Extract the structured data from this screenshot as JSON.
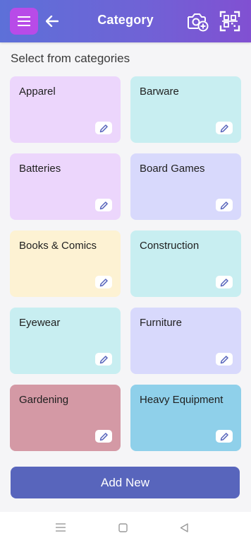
{
  "app_bar": {
    "title": "Category"
  },
  "icons": {
    "menu": "hamburger-menu-icon",
    "back": "arrow-left-icon",
    "camera": "camera-add-icon",
    "scan": "qr-scan-icon",
    "edit": "pencil-icon"
  },
  "section_heading": "Select from categories",
  "categories": [
    {
      "name": "Apparel",
      "color": "#ecd6fc"
    },
    {
      "name": "Barware",
      "color": "#c8eef1"
    },
    {
      "name": "Batteries",
      "color": "#ecd6fc"
    },
    {
      "name": "Board Games",
      "color": "#d8d9fc"
    },
    {
      "name": "Books & Comics",
      "color": "#fdf2d3"
    },
    {
      "name": "Construction",
      "color": "#c8eef1"
    },
    {
      "name": "Eyewear",
      "color": "#c8eef1"
    },
    {
      "name": "Furniture",
      "color": "#d8d9fc"
    },
    {
      "name": "Gardening",
      "color": "#d499a5"
    },
    {
      "name": "Heavy Equipment",
      "color": "#8fd0ea"
    }
  ],
  "add_button_label": "Add New",
  "colors": {
    "app_bar_start": "#5d70d8",
    "app_bar_end": "#8150d2",
    "menu_button": "#b84be8",
    "add_button": "#5865bc",
    "edit_icon": "#5865bc"
  }
}
